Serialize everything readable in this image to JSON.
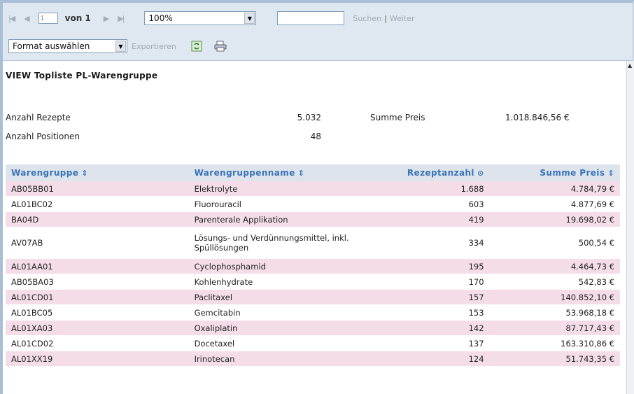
{
  "toolbar": {
    "first_page_icon": "first-page-icon",
    "prev_page_icon": "previous-page-icon",
    "page_input": "1",
    "page_of": "von 1",
    "next_page_icon": "next-page-icon",
    "last_page_icon": "last-page-icon",
    "zoom_value": "100%",
    "search_value": "",
    "search_label": "Suchen",
    "search_separator": "|",
    "next_label": "Weiter",
    "format_value": "Format auswählen",
    "export_label": "Exportieren",
    "refresh_icon": "refresh-icon",
    "print_icon": "print-icon"
  },
  "report": {
    "title": "VIEW Topliste PL-Warengruppe",
    "summary": {
      "rezepte_label": "Anzahl Rezepte",
      "rezepte_value": "5.032",
      "positionen_label": "Anzahl Positionen",
      "positionen_value": "48",
      "preis_label": "Summe Preis",
      "preis_value": "1.018.846,56 €"
    },
    "table": {
      "headers": [
        "Warengruppe",
        "Warengruppenname",
        "Rezeptanzahl",
        "Summe Preis"
      ],
      "rows": [
        [
          "AB05BB01",
          "Elektrolyte",
          "1.688",
          "4.784,79 €"
        ],
        [
          "AL01BC02",
          "Fluorouracil",
          "603",
          "4.877,69 €"
        ],
        [
          "BA04D",
          "Parenterale Applikation",
          "419",
          "19.698,02 €"
        ],
        [
          "AV07AB",
          "Lösungs- und Verdünnungsmittel, inkl. Spüllösungen",
          "334",
          "500,54 €"
        ],
        [
          "AL01AA01",
          "Cyclophosphamid",
          "195",
          "4.464,73 €"
        ],
        [
          "AB05BA03",
          "Kohlenhydrate",
          "170",
          "542,83 €"
        ],
        [
          "AL01CD01",
          "Paclitaxel",
          "157",
          "140.852,10 €"
        ],
        [
          "AL01BC05",
          "Gemcitabin",
          "153",
          "53.968,18 €"
        ],
        [
          "AL01XA03",
          "Oxaliplatin",
          "142",
          "87.717,43 €"
        ],
        [
          "AL01CD02",
          "Docetaxel",
          "137",
          "163.310,86 €"
        ],
        [
          "AL01XX19",
          "Irinotecan",
          "124",
          "51.743,35 €"
        ]
      ]
    }
  },
  "colors": {
    "header_text": "#3a74b8",
    "pink_row": "#f4dde9",
    "toolbar_bg": "#dfe7f1"
  }
}
